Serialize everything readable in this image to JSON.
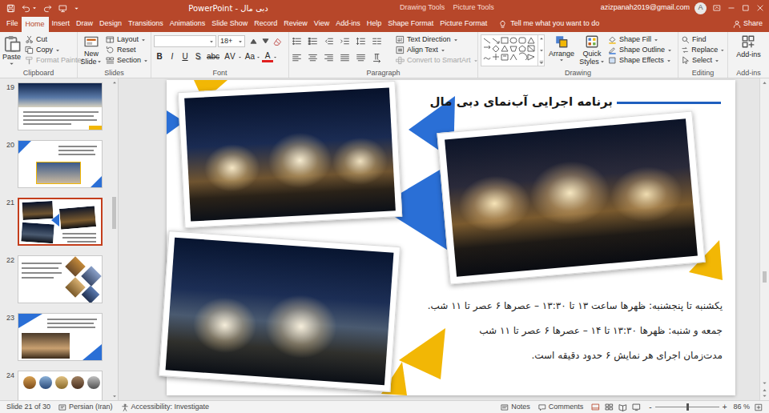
{
  "window": {
    "title": "دبی مال - PowerPoint",
    "context_tabs": [
      "Drawing Tools",
      "Picture Tools"
    ],
    "account": "azizpanah2019@gmail.com",
    "avatar": "A"
  },
  "tabs": [
    {
      "label": "File",
      "selected": false
    },
    {
      "label": "Home",
      "selected": true
    },
    {
      "label": "Insert",
      "selected": false
    },
    {
      "label": "Draw",
      "selected": false
    },
    {
      "label": "Design",
      "selected": false
    },
    {
      "label": "Transitions",
      "selected": false
    },
    {
      "label": "Animations",
      "selected": false
    },
    {
      "label": "Slide Show",
      "selected": false
    },
    {
      "label": "Record",
      "selected": false
    },
    {
      "label": "Review",
      "selected": false
    },
    {
      "label": "View",
      "selected": false
    },
    {
      "label": "Add-ins",
      "selected": false
    },
    {
      "label": "Help",
      "selected": false
    },
    {
      "label": "Shape Format",
      "selected": false
    },
    {
      "label": "Picture Format",
      "selected": false
    }
  ],
  "tell_me": "Tell me what you want to do",
  "share": "Share",
  "ribbon": {
    "clipboard": {
      "label": "Clipboard",
      "paste": "Paste",
      "cut": "Cut",
      "copy": "Copy",
      "format_painter": {
        "label": "Format Painter",
        "disabled": true
      }
    },
    "slides": {
      "label": "Slides",
      "new_slide": "New Slide",
      "layout": "Layout",
      "reset": "Reset",
      "section": "Section"
    },
    "font": {
      "label": "Font",
      "size": "18+",
      "buttons": [
        {
          "label": "B",
          "kind": "bold"
        },
        {
          "label": "I",
          "kind": "italic"
        },
        {
          "label": "U",
          "kind": "underline"
        },
        {
          "label": "S",
          "kind": "shadow"
        },
        {
          "label": "abc",
          "kind": "strike"
        },
        {
          "label": "AV",
          "kind": "spacing"
        },
        {
          "label": "Aa",
          "kind": "case"
        },
        {
          "label": "A",
          "kind": "color"
        }
      ]
    },
    "paragraph": {
      "label": "Paragraph",
      "text_direction": "Text Direction",
      "align_text": "Align Text",
      "convert": {
        "label": "Convert to SmartArt",
        "disabled": true
      }
    },
    "drawing": {
      "label": "Drawing",
      "arrange": "Arrange",
      "quick_styles": "Quick Styles",
      "shape_fill": "Shape Fill",
      "shape_outline": "Shape Outline",
      "shape_effects": "Shape Effects"
    },
    "editing": {
      "label": "Editing",
      "find": "Find",
      "replace": "Replace",
      "select": "Select"
    },
    "addins": {
      "label": "Add-ins",
      "button": "Add-ins"
    }
  },
  "thumbnails": [
    {
      "number": "19",
      "selected": false
    },
    {
      "number": "20",
      "selected": false
    },
    {
      "number": "21",
      "selected": true
    },
    {
      "number": "22",
      "selected": false
    },
    {
      "number": "23",
      "selected": false
    },
    {
      "number": "24",
      "selected": false
    }
  ],
  "slide": {
    "title": "برنامه اجرایی آب‌نمای دبی مال",
    "lines": [
      "یکشنبه تا پنجشنبه: ظهرها ساعت ۱۳ تا ۱۳:۳۰ – عصرها ۶ عصر تا ۱۱ شب.",
      "جمعه و شنبه: ظهرها ۱۳:۳۰ تا ۱۴ – عصرها ۶ عصر تا ۱۱ شب",
      "مدت‌زمان اجرای هر نمایش ۶ حدود دقیقه است."
    ]
  },
  "status_bar": {
    "slide": "Slide 21 of 30",
    "language": "Persian (Iran)",
    "accessibility": "Accessibility: Investigate",
    "notes": "Notes",
    "comments": "Comments",
    "zoom_out": "-",
    "zoom_in": "+",
    "zoom": "86 %",
    "zoom_level": 0.5
  }
}
